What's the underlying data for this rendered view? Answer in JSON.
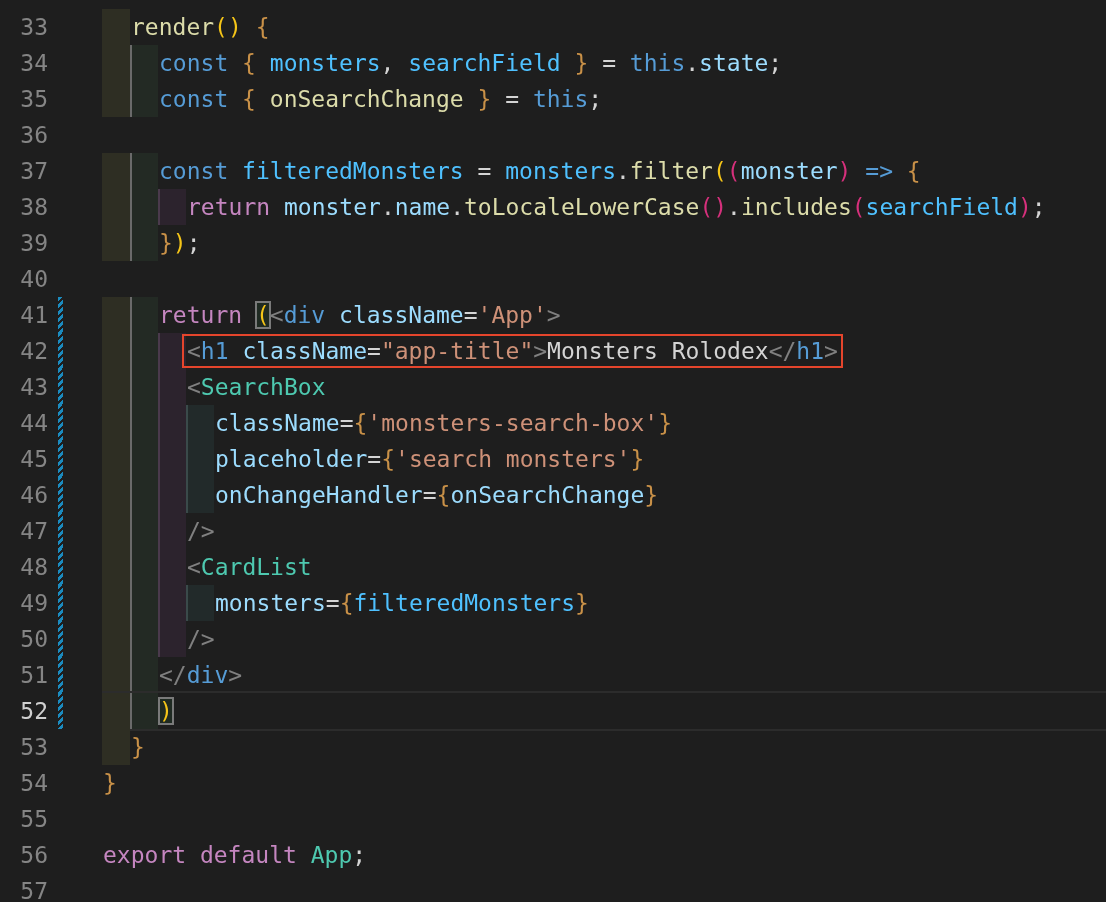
{
  "editor": {
    "lines": [
      {
        "children": [
          {
            "number": "33",
            "modified": false,
            "current": false,
            "boxed": false,
            "tokens": [
              {
                "text": "render",
                "kind": "fn"
              },
              {
                "text": "(",
                "kind": "b1"
              },
              {
                "text": ")",
                "kind": "b1"
              },
              {
                "text": " {",
                "kind": "b3"
              }
            ],
            "children": [
              {
                "number": "34",
                "modified": false,
                "current": false,
                "boxed": false,
                "tokens": [
                  {
                    "text": "const ",
                    "kind": "kw"
                  },
                  {
                    "text": "{ ",
                    "kind": "b3"
                  },
                  {
                    "text": "monsters",
                    "kind": "cvar"
                  },
                  {
                    "text": ", ",
                    "kind": "p"
                  },
                  {
                    "text": "searchField ",
                    "kind": "cvar"
                  },
                  {
                    "text": "}",
                    "kind": "b3"
                  },
                  {
                    "text": " = ",
                    "kind": "p"
                  },
                  {
                    "text": "this",
                    "kind": "kw"
                  },
                  {
                    "text": ".",
                    "kind": "p"
                  },
                  {
                    "text": "state",
                    "kind": "var"
                  },
                  {
                    "text": ";",
                    "kind": "p"
                  }
                ]
              },
              {
                "number": "35",
                "modified": false,
                "current": false,
                "boxed": false,
                "tokens": [
                  {
                    "text": "const ",
                    "kind": "kw"
                  },
                  {
                    "text": "{ ",
                    "kind": "b3"
                  },
                  {
                    "text": "onSearchChange ",
                    "kind": "fn"
                  },
                  {
                    "text": "}",
                    "kind": "b3"
                  },
                  {
                    "text": " = ",
                    "kind": "p"
                  },
                  {
                    "text": "this",
                    "kind": "kw"
                  },
                  {
                    "text": ";",
                    "kind": "p"
                  }
                ]
              },
              {
                "number": "36",
                "modified": false,
                "current": false,
                "boxed": false
              },
              {
                "number": "37",
                "modified": false,
                "current": false,
                "boxed": false,
                "tokens": [
                  {
                    "text": "const ",
                    "kind": "kw"
                  },
                  {
                    "text": "filteredMonsters",
                    "kind": "cvar"
                  },
                  {
                    "text": " = ",
                    "kind": "p"
                  },
                  {
                    "text": "monsters",
                    "kind": "cvar"
                  },
                  {
                    "text": ".",
                    "kind": "p"
                  },
                  {
                    "text": "filter",
                    "kind": "fn"
                  },
                  {
                    "text": "(",
                    "kind": "b1"
                  },
                  {
                    "text": "(",
                    "kind": "b2"
                  },
                  {
                    "text": "monster",
                    "kind": "var"
                  },
                  {
                    "text": ")",
                    "kind": "b2"
                  },
                  {
                    "text": " => ",
                    "kind": "kw"
                  },
                  {
                    "text": "{",
                    "kind": "b3"
                  }
                ],
                "children": [
                  {
                    "number": "38",
                    "modified": false,
                    "current": false,
                    "boxed": false,
                    "tokens": [
                      {
                        "text": "return ",
                        "kind": "ctl"
                      },
                      {
                        "text": "monster",
                        "kind": "var"
                      },
                      {
                        "text": ".",
                        "kind": "p"
                      },
                      {
                        "text": "name",
                        "kind": "var"
                      },
                      {
                        "text": ".",
                        "kind": "p"
                      },
                      {
                        "text": "toLocaleLowerCase",
                        "kind": "fn"
                      },
                      {
                        "text": "(",
                        "kind": "b2"
                      },
                      {
                        "text": ")",
                        "kind": "b2"
                      },
                      {
                        "text": ".",
                        "kind": "p"
                      },
                      {
                        "text": "includes",
                        "kind": "fn"
                      },
                      {
                        "text": "(",
                        "kind": "b2"
                      },
                      {
                        "text": "searchField",
                        "kind": "cvar"
                      },
                      {
                        "text": ")",
                        "kind": "b2"
                      },
                      {
                        "text": ";",
                        "kind": "p"
                      }
                    ]
                  }
                ]
              },
              {
                "number": "39",
                "modified": false,
                "current": false,
                "boxed": false,
                "tokens": [
                  {
                    "text": "}",
                    "kind": "b3"
                  },
                  {
                    "text": ")",
                    "kind": "b1"
                  },
                  {
                    "text": ";",
                    "kind": "p"
                  }
                ]
              },
              {
                "number": "40",
                "modified": false,
                "current": false,
                "boxed": false
              },
              {
                "number": "41",
                "modified": true,
                "current": false,
                "boxed": false,
                "tokens": [
                  {
                    "text": "return ",
                    "kind": "ctl"
                  },
                  {
                    "text": "(",
                    "kind": "match"
                  },
                  {
                    "text": "<",
                    "kind": "tag"
                  },
                  {
                    "text": "div",
                    "kind": "tname"
                  },
                  {
                    "text": " className",
                    "kind": "attr"
                  },
                  {
                    "text": "=",
                    "kind": "p"
                  },
                  {
                    "text": "'App'",
                    "kind": "str"
                  },
                  {
                    "text": ">",
                    "kind": "tag"
                  }
                ],
                "children": [
                  {
                    "number": "42",
                    "modified": true,
                    "current": false,
                    "boxed": true,
                    "tokens": [
                      {
                        "text": "<",
                        "kind": "tag"
                      },
                      {
                        "text": "h1",
                        "kind": "tname"
                      },
                      {
                        "text": " className",
                        "kind": "attr"
                      },
                      {
                        "text": "=",
                        "kind": "p"
                      },
                      {
                        "text": "\"app-title\"",
                        "kind": "str"
                      },
                      {
                        "text": ">",
                        "kind": "tag"
                      },
                      {
                        "text": "Monsters Rolodex",
                        "kind": "p"
                      },
                      {
                        "text": "</",
                        "kind": "tag"
                      },
                      {
                        "text": "h1",
                        "kind": "tname"
                      },
                      {
                        "text": ">",
                        "kind": "tag"
                      }
                    ]
                  },
                  {
                    "number": "43",
                    "modified": true,
                    "current": false,
                    "boxed": false,
                    "tokens": [
                      {
                        "text": "<",
                        "kind": "tag"
                      },
                      {
                        "text": "SearchBox",
                        "kind": "comp"
                      }
                    ],
                    "children": [
                      {
                        "number": "44",
                        "modified": true,
                        "current": false,
                        "boxed": false,
                        "tokens": [
                          {
                            "text": "className",
                            "kind": "attr"
                          },
                          {
                            "text": "=",
                            "kind": "p"
                          },
                          {
                            "text": "{",
                            "kind": "b3"
                          },
                          {
                            "text": "'monsters-search-box'",
                            "kind": "str"
                          },
                          {
                            "text": "}",
                            "kind": "b3"
                          }
                        ]
                      },
                      {
                        "number": "45",
                        "modified": true,
                        "current": false,
                        "boxed": false,
                        "tokens": [
                          {
                            "text": "placeholder",
                            "kind": "attr"
                          },
                          {
                            "text": "=",
                            "kind": "p"
                          },
                          {
                            "text": "{",
                            "kind": "b3"
                          },
                          {
                            "text": "'search monsters'",
                            "kind": "str"
                          },
                          {
                            "text": "}",
                            "kind": "b3"
                          }
                        ]
                      },
                      {
                        "number": "46",
                        "modified": true,
                        "current": false,
                        "boxed": false,
                        "tokens": [
                          {
                            "text": "onChangeHandler",
                            "kind": "attr"
                          },
                          {
                            "text": "=",
                            "kind": "p"
                          },
                          {
                            "text": "{",
                            "kind": "b3"
                          },
                          {
                            "text": "onSearchChange",
                            "kind": "var"
                          },
                          {
                            "text": "}",
                            "kind": "b3"
                          }
                        ]
                      }
                    ]
                  },
                  {
                    "number": "47",
                    "modified": true,
                    "current": false,
                    "boxed": false,
                    "tokens": [
                      {
                        "text": "/>",
                        "kind": "tag"
                      }
                    ]
                  },
                  {
                    "number": "48",
                    "modified": true,
                    "current": false,
                    "boxed": false,
                    "tokens": [
                      {
                        "text": "<",
                        "kind": "tag"
                      },
                      {
                        "text": "CardList",
                        "kind": "comp"
                      }
                    ],
                    "children": [
                      {
                        "number": "49",
                        "modified": true,
                        "current": false,
                        "boxed": false,
                        "tokens": [
                          {
                            "text": "monsters",
                            "kind": "attr"
                          },
                          {
                            "text": "=",
                            "kind": "p"
                          },
                          {
                            "text": "{",
                            "kind": "b3"
                          },
                          {
                            "text": "filteredMonsters",
                            "kind": "cvar"
                          },
                          {
                            "text": "}",
                            "kind": "b3"
                          }
                        ]
                      }
                    ]
                  },
                  {
                    "number": "50",
                    "modified": true,
                    "current": false,
                    "boxed": false,
                    "tokens": [
                      {
                        "text": "/>",
                        "kind": "tag"
                      }
                    ]
                  }
                ]
              },
              {
                "number": "51",
                "modified": true,
                "current": false,
                "boxed": false,
                "tokens": [
                  {
                    "text": "</",
                    "kind": "tag"
                  },
                  {
                    "text": "div",
                    "kind": "tname"
                  },
                  {
                    "text": ">",
                    "kind": "tag"
                  }
                ]
              },
              {
                "number": "52",
                "modified": true,
                "current": true,
                "boxed": false,
                "tokens": [
                  {
                    "text": ")",
                    "kind": "match"
                  }
                ]
              }
            ]
          },
          {
            "number": "53",
            "modified": false,
            "current": false,
            "boxed": false,
            "tokens": [
              {
                "text": "}",
                "kind": "b3"
              }
            ]
          }
        ]
      },
      {
        "number": "54",
        "modified": false,
        "current": false,
        "boxed": false,
        "tokens": [
          {
            "text": "}",
            "kind": "b3"
          }
        ]
      },
      {
        "number": "55",
        "modified": false,
        "current": false,
        "boxed": false
      },
      {
        "number": "56",
        "modified": false,
        "current": false,
        "boxed": false,
        "tokens": [
          {
            "text": "export default ",
            "kind": "ctl"
          },
          {
            "text": "App",
            "kind": "comp"
          },
          {
            "text": ";",
            "kind": "p"
          }
        ]
      },
      {
        "number": "57",
        "modified": false,
        "current": false,
        "boxed": false
      }
    ]
  }
}
